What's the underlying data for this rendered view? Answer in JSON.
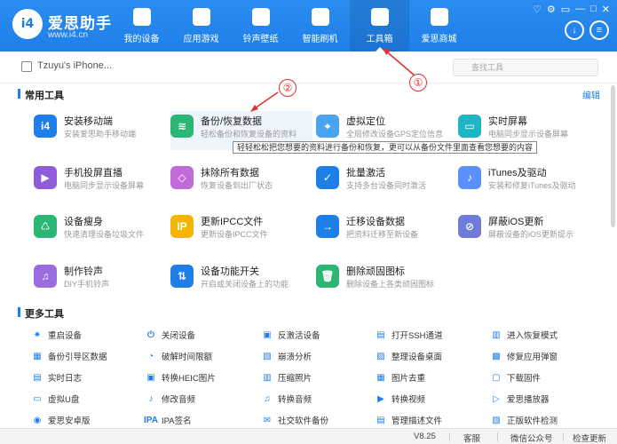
{
  "header": {
    "logo_text": "i4",
    "brand_name": "爱思助手",
    "brand_url": "www.i4.cn",
    "nav": [
      {
        "label": "我的设备",
        "icon": "apple-icon"
      },
      {
        "label": "应用游戏",
        "icon": "appstore-icon"
      },
      {
        "label": "铃声壁纸",
        "icon": "music-icon"
      },
      {
        "label": "智能刷机",
        "icon": "gear-icon"
      },
      {
        "label": "工具箱",
        "icon": "toolbox-icon",
        "active": true
      },
      {
        "label": "爱思商城",
        "icon": "shop-bag-icon"
      }
    ],
    "win_ctrls": [
      "♡",
      "⚙",
      "▭",
      "—",
      "□",
      "✕"
    ]
  },
  "device": {
    "name": "Tzuyu's iPhone..."
  },
  "search": {
    "placeholder": "查找工具"
  },
  "sections": {
    "common_title": "常用工具",
    "edit_label": "编辑",
    "more_title": "更多工具"
  },
  "tools": [
    {
      "name": "安装移动端",
      "desc": "安装爱思助手移动端",
      "color": "#1f7fe8",
      "glyph": "i4"
    },
    {
      "name": "备份/恢复数据",
      "desc": "轻松备份和恢复设备的资料",
      "color": "#2bb673",
      "glyph": "≋"
    },
    {
      "name": "虚拟定位",
      "desc": "全局修改设备GPS定位信息",
      "color": "#4aa3f0",
      "glyph": "⌖"
    },
    {
      "name": "实时屏幕",
      "desc": "电脑同步显示设备屏幕",
      "color": "#1fb5c4",
      "glyph": "▭"
    },
    {
      "name": "手机投屏直播",
      "desc": "电脑同步显示设备屏幕",
      "color": "#8e5cd9",
      "glyph": "▶"
    },
    {
      "name": "抹除所有数据",
      "desc": "恢复设备到出厂状态",
      "color": "#c36ad9",
      "glyph": "◇"
    },
    {
      "name": "批量激活",
      "desc": "支持多台设备同时激活",
      "color": "#1f7fe8",
      "glyph": "✓"
    },
    {
      "name": "iTunes及驱动",
      "desc": "安装和修复iTunes及驱动",
      "color": "#5b8ff9",
      "glyph": "♪"
    },
    {
      "name": "设备瘦身",
      "desc": "快速清理设备垃圾文件",
      "color": "#2bb673",
      "glyph": "♺"
    },
    {
      "name": "更新IPCC文件",
      "desc": "更新设备IPCC文件",
      "color": "#f5b400",
      "glyph": "IP"
    },
    {
      "name": "迁移设备数据",
      "desc": "把资料迁移至新设备",
      "color": "#1f7fe8",
      "glyph": "→"
    },
    {
      "name": "屏蔽iOS更新",
      "desc": "屏蔽设备的iOS更新提示",
      "color": "#6f7bd9",
      "glyph": "⊘"
    },
    {
      "name": "制作铃声",
      "desc": "DIY手机铃声",
      "color": "#9b6be0",
      "glyph": "♫"
    },
    {
      "name": "设备功能开关",
      "desc": "开启或关闭设备上的功能",
      "color": "#1f7fe8",
      "glyph": "⇅"
    },
    {
      "name": "删除顽固图标",
      "desc": "删除设备上各类顽固图标",
      "color": "#2bb673",
      "glyph": "🗑"
    }
  ],
  "tooltip": "轻轻松松把您想要的资料进行备份和恢复，更可以从备份文件里面查看您想要的内容",
  "more_tools": [
    [
      "重启设备",
      "关闭设备",
      "反激活设备",
      "打开SSH通道",
      "进入恢复模式"
    ],
    [
      "备份引导区数据",
      "破解时间限额",
      "崩溃分析",
      "整理设备桌面",
      "修复应用弹窗"
    ],
    [
      "实时日志",
      "转换HEIC图片",
      "压缩照片",
      "图片去重",
      "下载固件"
    ],
    [
      "虚拟U盘",
      "修改音频",
      "转换音频",
      "转换视频",
      "爱思播放器"
    ],
    [
      "爱思安卓版",
      "IPA签名",
      "社交软件备份",
      "管理描述文件",
      "正版软件检测"
    ]
  ],
  "more_glyphs": [
    [
      "✷",
      "⏻",
      "▣",
      "▤",
      "▥"
    ],
    [
      "▦",
      "◔",
      "▧",
      "▨",
      "▩"
    ],
    [
      "▤",
      "▣",
      "▥",
      "▦",
      "▢"
    ],
    [
      "▭",
      "♪",
      "♫",
      "▶",
      "▷"
    ],
    [
      "◉",
      "IPA",
      "✉",
      "▤",
      "▧"
    ]
  ],
  "status": {
    "version": "V8.25",
    "service": "客服",
    "wechat": "微信公众号",
    "update": "检查更新"
  },
  "annotations": [
    "①",
    "②"
  ],
  "colors": {
    "accent": "#1f7fe8",
    "annotation": "#e03030"
  }
}
